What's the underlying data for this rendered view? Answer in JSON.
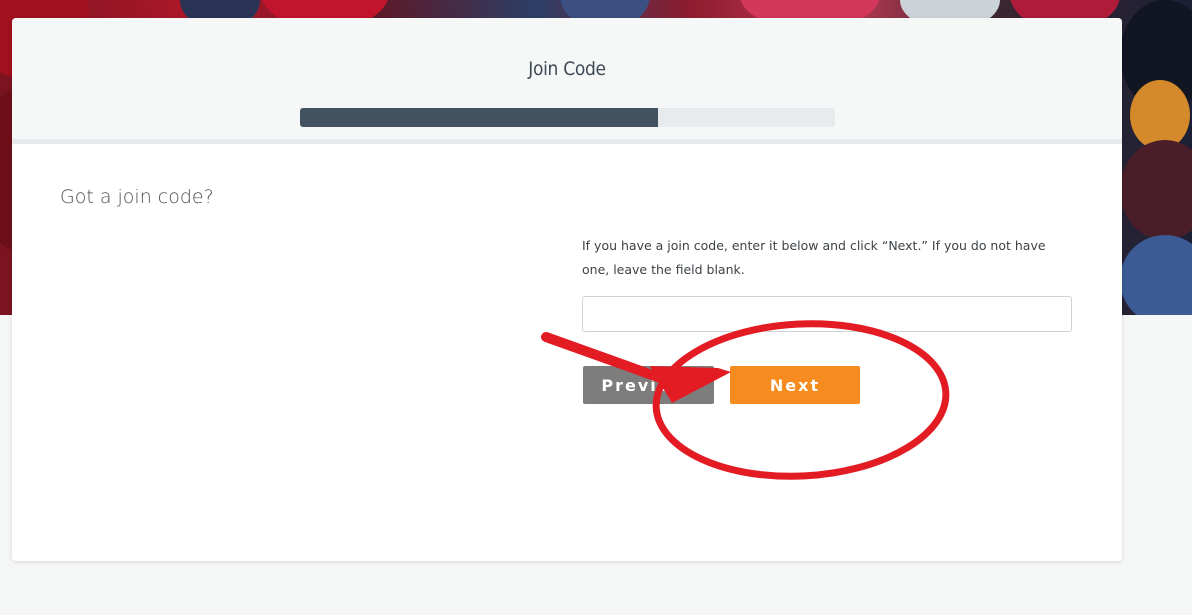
{
  "colors": {
    "accent": "#f68b1f",
    "progress_fill": "#435260",
    "progress_track": "#e8ebee",
    "secondary_button": "#7d7d7d",
    "annotation_red": "#e31b23"
  },
  "wizard": {
    "step_title": "Join Code",
    "progress_fraction": 0.67
  },
  "form": {
    "question": "Got a join code?",
    "instructions": "If you have a join code, enter it below and click “Next.” If you do not have one, leave the field blank.",
    "join_code_value": "",
    "join_code_placeholder": ""
  },
  "buttons": {
    "previous_label": "Previous",
    "next_label": "Next"
  },
  "annotation": {
    "arrow_icon": "red-arrow-icon",
    "circle_icon": "red-ellipse-icon"
  }
}
